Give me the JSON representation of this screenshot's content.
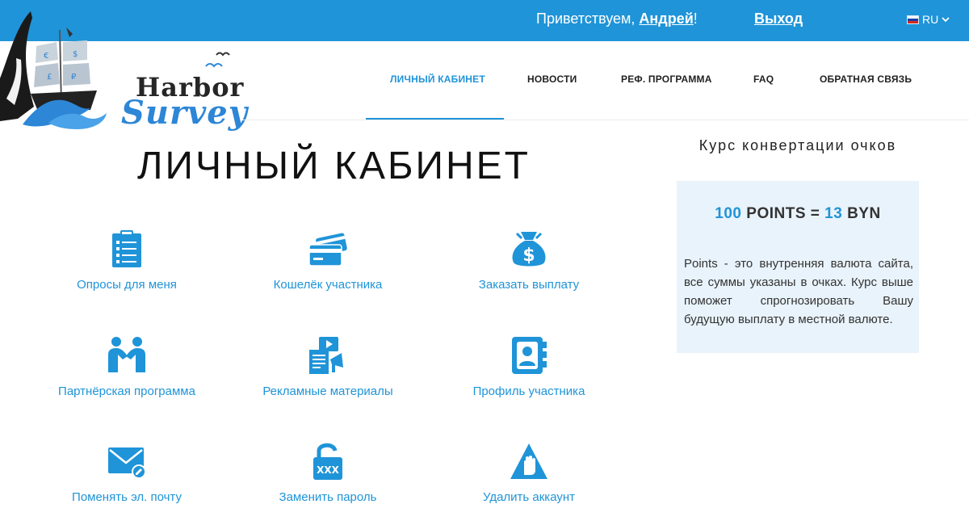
{
  "header": {
    "greeting_prefix": "Приветствуем, ",
    "user_name": "Андрей",
    "greeting_suffix": "!",
    "logout_label": "Выход",
    "language": "RU"
  },
  "logo": {
    "line1": "Harbor",
    "line2": "Survey"
  },
  "nav": {
    "items": [
      {
        "label": "ЛИЧНЫЙ КАБИНЕТ",
        "active": true
      },
      {
        "label": "НОВОСТИ",
        "active": false
      },
      {
        "label": "РЕФ. ПРОГРАММА",
        "active": false
      },
      {
        "label": "FAQ",
        "active": false
      },
      {
        "label": "ОБРАТНАЯ СВЯЗЬ",
        "active": false
      }
    ]
  },
  "page": {
    "title": "ЛИЧНЫЙ КАБИНЕТ"
  },
  "tiles": [
    {
      "label": "Опросы для меня",
      "icon": "clipboard-list-icon"
    },
    {
      "label": "Кошелёк участника",
      "icon": "credit-cards-icon"
    },
    {
      "label": "Заказать выплату",
      "icon": "money-bag-icon"
    },
    {
      "label": "Партнёрская программа",
      "icon": "handshake-icon"
    },
    {
      "label": "Рекламные материалы",
      "icon": "promo-materials-icon"
    },
    {
      "label": "Профиль участника",
      "icon": "address-book-icon"
    },
    {
      "label": "Поменять эл. почту",
      "icon": "envelope-edit-icon"
    },
    {
      "label": "Заменить пароль",
      "icon": "unlocked-padlock-icon"
    },
    {
      "label": "Удалить аккаунт",
      "icon": "warning-hand-icon"
    }
  ],
  "conversion": {
    "heading": "Курс конвертации очков",
    "points_value": "100",
    "points_unit": "POINTS =",
    "money_value": "13",
    "money_unit": "BYN",
    "description": "Points - это внутренняя валюта сайта, все суммы указаны в очках. Курс выше поможет спрогнозировать Вашу будущую выплату в местной валюте."
  },
  "colors": {
    "accent": "#1f94d8",
    "info_box": "#e9f3fb"
  }
}
